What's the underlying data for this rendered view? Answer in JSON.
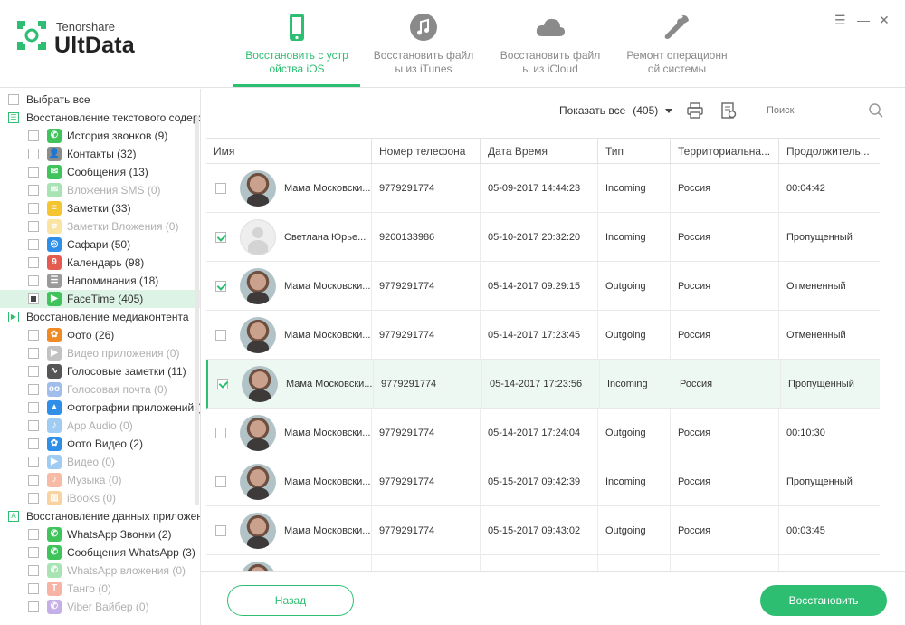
{
  "app": {
    "brand_sub": "Tenorshare",
    "brand_main": "UltData",
    "accent": "#2dbe72"
  },
  "tabs": [
    {
      "label": "Восстановить с устройства iOS",
      "line1": "Восстановить с устр",
      "line2": "ойства iOS",
      "icon": "phone-icon",
      "active": true
    },
    {
      "label": "Восстановить файлы из iTunes",
      "line1": "Восстановить файл",
      "line2": "ы из iTunes",
      "icon": "music-icon",
      "active": false
    },
    {
      "label": "Восстановить файлы из iCloud",
      "line1": "Восстановить файл",
      "line2": "ы из iCloud",
      "icon": "cloud-icon",
      "active": false
    },
    {
      "label": "Ремонт операционной системы",
      "line1": "Ремонт операционн",
      "line2": "ой системы",
      "icon": "wrench-icon",
      "active": false
    }
  ],
  "window_controls": [
    "menu-icon",
    "minimize-icon",
    "close-icon"
  ],
  "sidebar": {
    "select_all": "Выбрать все",
    "rows": [
      {
        "type": "category",
        "label": "Восстановление текстового содержи",
        "icon": "text-category-icon",
        "glyph": "☰"
      },
      {
        "type": "item",
        "label": "История звонков (9)",
        "icon": "phone-icon",
        "color": "#3fc35a",
        "glyph": "✆"
      },
      {
        "type": "item",
        "label": "Контакты (32)",
        "icon": "contacts-icon",
        "color": "#8c8c8c",
        "glyph": "👤"
      },
      {
        "type": "item",
        "label": "Сообщения (13)",
        "icon": "messages-icon",
        "color": "#3fc35a",
        "glyph": "✉"
      },
      {
        "type": "item",
        "label": "Вложения SMS (0)",
        "icon": "sms-attachment-icon",
        "color": "#3fc35a",
        "glyph": "✉",
        "disabled": true
      },
      {
        "type": "item",
        "label": "Заметки (33)",
        "icon": "notes-icon",
        "color": "#f5c431",
        "glyph": "≡"
      },
      {
        "type": "item",
        "label": "Заметки Вложения (0)",
        "icon": "notes-attachment-icon",
        "color": "#f5c431",
        "glyph": "⌀",
        "disabled": true
      },
      {
        "type": "item",
        "label": "Сафари (50)",
        "icon": "safari-icon",
        "color": "#2f8fe8",
        "glyph": "◎"
      },
      {
        "type": "item",
        "label": "Календарь (98)",
        "icon": "calendar-icon",
        "color": "#e45b4f",
        "glyph": "9"
      },
      {
        "type": "item",
        "label": "Напоминания (18)",
        "icon": "reminders-icon",
        "color": "#9a9a9a",
        "glyph": "☰"
      },
      {
        "type": "item",
        "label": "FaceTime (405)",
        "icon": "facetime-icon",
        "color": "#3fc35a",
        "glyph": "▶",
        "selected": true
      },
      {
        "type": "category",
        "label": "Восстановление медиаконтента",
        "icon": "media-category-icon",
        "glyph": "▶"
      },
      {
        "type": "item",
        "label": "Фото (26)",
        "icon": "photos-icon",
        "color": "#f08a24",
        "glyph": "✿"
      },
      {
        "type": "item",
        "label": "Видео приложения (0)",
        "icon": "app-video-icon",
        "color": "#7a7a7a",
        "glyph": "▶",
        "disabled": true
      },
      {
        "type": "item",
        "label": "Голосовые заметки (11)",
        "icon": "voice-memos-icon",
        "color": "#555555",
        "glyph": "∿"
      },
      {
        "type": "item",
        "label": "Голосовая почта (0)",
        "icon": "voicemail-icon",
        "color": "#2f6fd6",
        "glyph": "oo",
        "disabled": true
      },
      {
        "type": "item",
        "label": "Фотографии приложений (24",
        "icon": "app-photos-icon",
        "color": "#2f8fe8",
        "glyph": "▲"
      },
      {
        "type": "item",
        "label": "App Audio (0)",
        "icon": "app-audio-icon",
        "color": "#2f8fe8",
        "glyph": "♪",
        "disabled": true
      },
      {
        "type": "item",
        "label": "Фото Видео (2)",
        "icon": "photo-video-icon",
        "color": "#2f8fe8",
        "glyph": "✿"
      },
      {
        "type": "item",
        "label": "Видео (0)",
        "icon": "video-icon",
        "color": "#2f8fe8",
        "glyph": "▶",
        "disabled": true
      },
      {
        "type": "item",
        "label": "Музыка (0)",
        "icon": "music-icon",
        "color": "#ef6a3a",
        "glyph": "♪",
        "disabled": true
      },
      {
        "type": "item",
        "label": "iBooks (0)",
        "icon": "ibooks-icon",
        "color": "#f0a030",
        "glyph": "▥",
        "disabled": true
      },
      {
        "type": "category",
        "label": "Восстановление данных приложений",
        "icon": "apps-category-icon",
        "glyph": "A"
      },
      {
        "type": "item",
        "label": "WhatsApp Звонки (2)",
        "icon": "whatsapp-calls-icon",
        "color": "#3fc35a",
        "glyph": "✆"
      },
      {
        "type": "item",
        "label": "Сообщения WhatsApp (3)",
        "icon": "whatsapp-messages-icon",
        "color": "#3fc35a",
        "glyph": "✆"
      },
      {
        "type": "item",
        "label": "WhatsApp вложения (0)",
        "icon": "whatsapp-attachments-icon",
        "color": "#3fc35a",
        "glyph": "✆",
        "disabled": true
      },
      {
        "type": "item",
        "label": "Танго (0)",
        "icon": "tango-icon",
        "color": "#ef5a3a",
        "glyph": "T",
        "disabled": true
      },
      {
        "type": "item",
        "label": "Viber Вайбер (0)",
        "icon": "viber-icon",
        "color": "#7d52c8",
        "glyph": "✆",
        "disabled": true
      }
    ]
  },
  "toolbar": {
    "show_label": "Показать все",
    "show_count": "(405)",
    "search_placeholder": "Поиск"
  },
  "table": {
    "columns": [
      "Имя",
      "Номер телефона",
      "Дата Время",
      "Тип",
      "Территориальна...",
      "Продолжитель..."
    ],
    "rows": [
      {
        "checked": false,
        "avatar": "photo",
        "name": "Мама Московски...",
        "phone": "9779291774",
        "datetime": "05-09-2017 14:44:23",
        "type": "Incoming",
        "territory": "Россия",
        "duration": "00:04:42",
        "highlight": false
      },
      {
        "checked": true,
        "avatar": "blank",
        "name": "Светлана Юрье...",
        "phone": "9200133986",
        "datetime": "05-10-2017 20:32:20",
        "type": "Incoming",
        "territory": "Россия",
        "duration": "Пропущенный",
        "highlight": false
      },
      {
        "checked": true,
        "avatar": "photo",
        "name": "Мама Московски...",
        "phone": "9779291774",
        "datetime": "05-14-2017 09:29:15",
        "type": "Outgoing",
        "territory": "Россия",
        "duration": "Отмененный",
        "highlight": false
      },
      {
        "checked": false,
        "avatar": "photo",
        "name": "Мама Московски...",
        "phone": "9779291774",
        "datetime": "05-14-2017 17:23:45",
        "type": "Outgoing",
        "territory": "Россия",
        "duration": "Отмененный",
        "highlight": false
      },
      {
        "checked": true,
        "avatar": "photo",
        "name": "Мама Московски...",
        "phone": "9779291774",
        "datetime": "05-14-2017 17:23:56",
        "type": "Incoming",
        "territory": "Россия",
        "duration": "Пропущенный",
        "highlight": true
      },
      {
        "checked": false,
        "avatar": "photo",
        "name": "Мама Московски...",
        "phone": "9779291774",
        "datetime": "05-14-2017 17:24:04",
        "type": "Outgoing",
        "territory": "Россия",
        "duration": "00:10:30",
        "highlight": false
      },
      {
        "checked": false,
        "avatar": "photo",
        "name": "Мама Московски...",
        "phone": "9779291774",
        "datetime": "05-15-2017 09:42:39",
        "type": "Incoming",
        "territory": "Россия",
        "duration": "Пропущенный",
        "highlight": false
      },
      {
        "checked": false,
        "avatar": "photo",
        "name": "Мама Московски...",
        "phone": "9779291774",
        "datetime": "05-15-2017 09:43:02",
        "type": "Outgoing",
        "territory": "Россия",
        "duration": "00:03:45",
        "highlight": false
      },
      {
        "checked": false,
        "avatar": "photo",
        "name": "",
        "phone": "",
        "datetime": "",
        "type": "",
        "territory": "",
        "duration": "",
        "highlight": false
      }
    ]
  },
  "footer": {
    "back_label": "Назад",
    "restore_label": "Восстановить"
  }
}
